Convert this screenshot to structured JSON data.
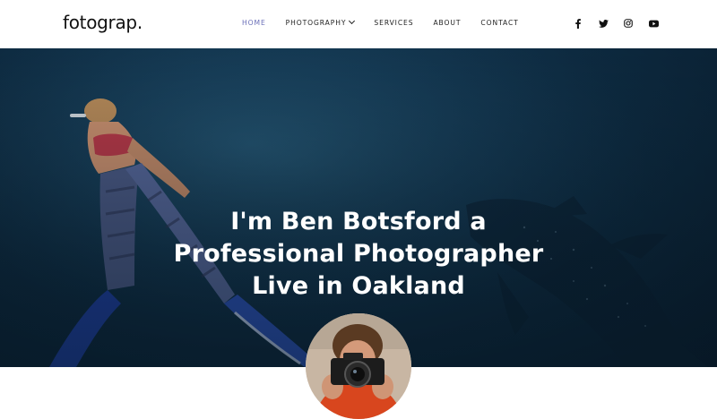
{
  "header": {
    "logo": "fotograp",
    "logo_dot": ".",
    "nav": [
      {
        "label": "HOME",
        "active": true
      },
      {
        "label": "PHOTOGRAPHY",
        "has_dropdown": true
      },
      {
        "label": "SERVICES"
      },
      {
        "label": "ABOUT"
      },
      {
        "label": "CONTACT"
      }
    ],
    "social": [
      "facebook-icon",
      "twitter-icon",
      "instagram-icon",
      "youtube-icon"
    ]
  },
  "hero": {
    "title_lines": [
      "I'm Ben Botsford a",
      "Professional Photographer",
      "Live in Oakland"
    ]
  },
  "colors": {
    "nav_active": "#6a6fb8",
    "hero_deep": "#081b2c",
    "hero_light": "#1d4a66"
  }
}
